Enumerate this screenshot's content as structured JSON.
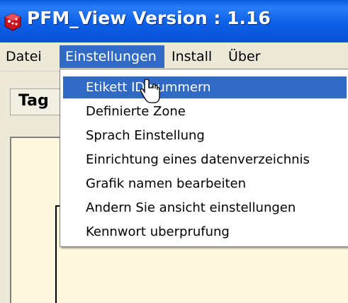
{
  "window": {
    "title": "PFM_View Version :  1.16",
    "icon": "app-icon"
  },
  "menubar": {
    "items": [
      {
        "label": "Datei"
      },
      {
        "label": "Einstellungen",
        "active": true
      },
      {
        "label": "Install"
      },
      {
        "label": "Über"
      }
    ]
  },
  "toolbar": {
    "tag_label": "Tag"
  },
  "dropdown": {
    "items": [
      {
        "label": "Etikett ID nummern",
        "highlighted": true
      },
      {
        "label": "Definierte Zone"
      },
      {
        "label": "Sprach Einstellung"
      },
      {
        "label": "Einrichtung eines datenverzeichnis"
      },
      {
        "label": "Grafik namen bearbeiten"
      },
      {
        "label": "Andern Sie ansicht einstellungen"
      },
      {
        "label": "Kennwort uberprufung"
      }
    ]
  },
  "colors": {
    "titlebar": "#0a5fe0",
    "highlight": "#316ac5",
    "content_bg": "#fdf8de",
    "menu_bg": "#ece9d8"
  },
  "cursor": "hand-pointer-icon"
}
